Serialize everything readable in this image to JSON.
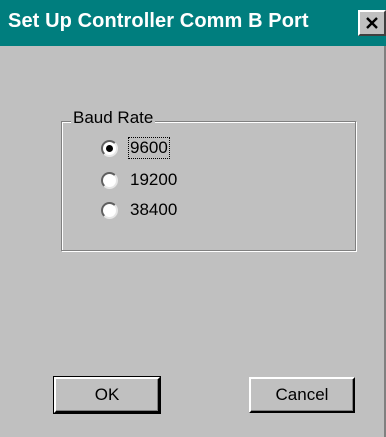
{
  "window": {
    "title": "Set Up Controller Comm B Port",
    "close_glyph": "✕"
  },
  "baud_rate": {
    "group_label": "Baud Rate",
    "selected": "9600",
    "options": [
      {
        "label": "9600",
        "checked": true
      },
      {
        "label": "19200",
        "checked": false
      },
      {
        "label": "38400",
        "checked": false
      }
    ]
  },
  "buttons": {
    "ok_label": "OK",
    "cancel_label": "Cancel"
  },
  "colors": {
    "title_bar": "#007e7e",
    "face": "#c0c0c0"
  }
}
